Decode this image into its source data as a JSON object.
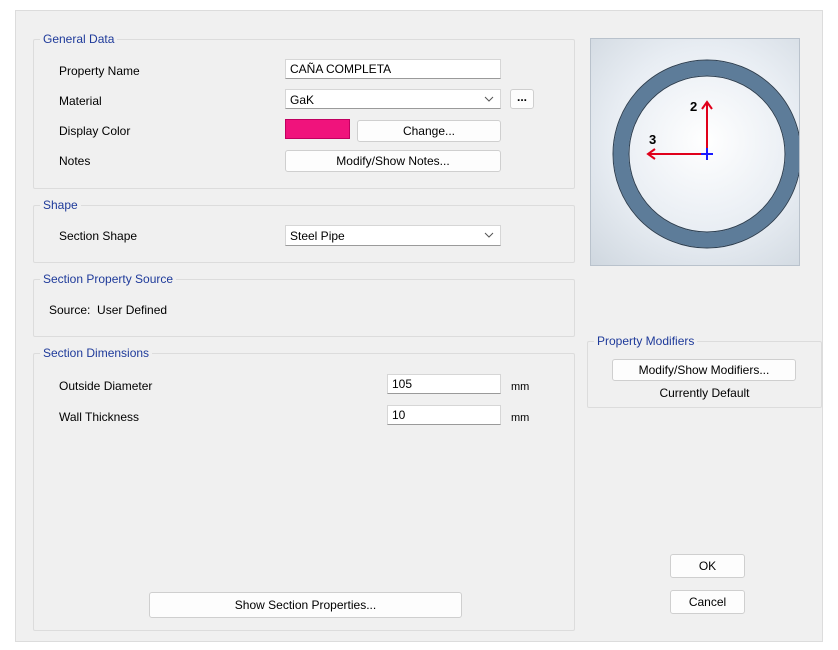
{
  "general_data": {
    "legend": "General Data",
    "property_name_label": "Property Name",
    "property_name_value": "CAÑA COMPLETA",
    "material_label": "Material",
    "material_value": "GaK",
    "material_more_button": "...",
    "display_color_label": "Display Color",
    "display_color": "#f0137c",
    "change_button": "Change...",
    "notes_label": "Notes",
    "notes_button": "Modify/Show Notes..."
  },
  "shape": {
    "legend": "Shape",
    "section_shape_label": "Section Shape",
    "section_shape_value": "Steel Pipe"
  },
  "source": {
    "legend": "Section Property Source",
    "text": "Source:  User Defined"
  },
  "dimensions": {
    "legend": "Section Dimensions",
    "outside_diameter_label": "Outside Diameter",
    "outside_diameter_value": "105",
    "outside_diameter_unit": "mm",
    "wall_thickness_label": "Wall Thickness",
    "wall_thickness_value": "10",
    "wall_thickness_unit": "mm",
    "show_properties_button": "Show Section Properties..."
  },
  "preview": {
    "axis_2_label": "2",
    "axis_3_label": "3",
    "ring_color": "#5d7c99",
    "axis_2_color": "#e0001b",
    "axis_3_color": "#e0001b",
    "origin_color": "#1a1aff"
  },
  "modifiers": {
    "legend": "Property Modifiers",
    "button": "Modify/Show Modifiers...",
    "status": "Currently Default"
  },
  "actions": {
    "ok": "OK",
    "cancel": "Cancel"
  }
}
